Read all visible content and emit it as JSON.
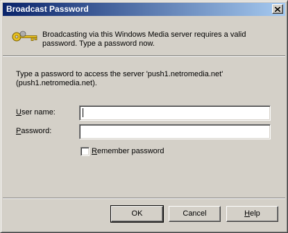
{
  "window": {
    "title": "Broadcast Password",
    "close_glyph": "×"
  },
  "header": {
    "icon": "key-icon",
    "message": "Broadcasting via this Windows Media server requires a valid password. Type a password now."
  },
  "body": {
    "instruction": "Type a password to access the server 'push1.netromedia.net' (push1.netromedia.net)."
  },
  "form": {
    "username": {
      "label_accel": "U",
      "label_rest": "ser name:",
      "value": ""
    },
    "password": {
      "label_accel": "P",
      "label_rest": "assword:",
      "value": ""
    },
    "remember": {
      "label_accel": "R",
      "label_rest": "emember password",
      "checked": false
    }
  },
  "buttons": {
    "ok": "OK",
    "cancel": "Cancel",
    "help_accel": "H",
    "help_rest": "elp"
  },
  "colors": {
    "title_gradient_start": "#0a246a",
    "title_gradient_end": "#a6caf0",
    "face": "#d4d0c8"
  }
}
